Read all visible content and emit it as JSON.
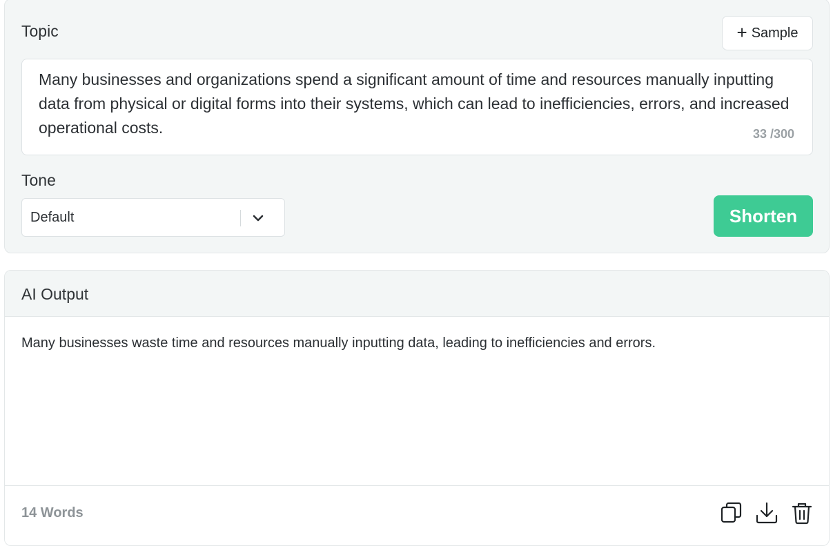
{
  "topic": {
    "label": "Topic",
    "sample_button": {
      "icon": "plus-icon",
      "label": "Sample"
    },
    "text": "Many businesses and organizations spend a significant amount of time and resources manually inputting data from physical or digital forms into their systems, which can lead to inefficiencies, errors, and increased operational costs.",
    "char_count": "33 /300"
  },
  "tone": {
    "label": "Tone",
    "selected": "Default",
    "chevron_icon": "chevron-down-icon"
  },
  "action_button": {
    "label": "Shorten",
    "color": "#3ecb94"
  },
  "output": {
    "title": "AI Output",
    "text": "Many businesses waste time and resources manually inputting data, leading to inefficiencies and errors.",
    "word_count": "14 Words",
    "actions": [
      "copy-icon",
      "download-icon",
      "trash-icon"
    ]
  }
}
